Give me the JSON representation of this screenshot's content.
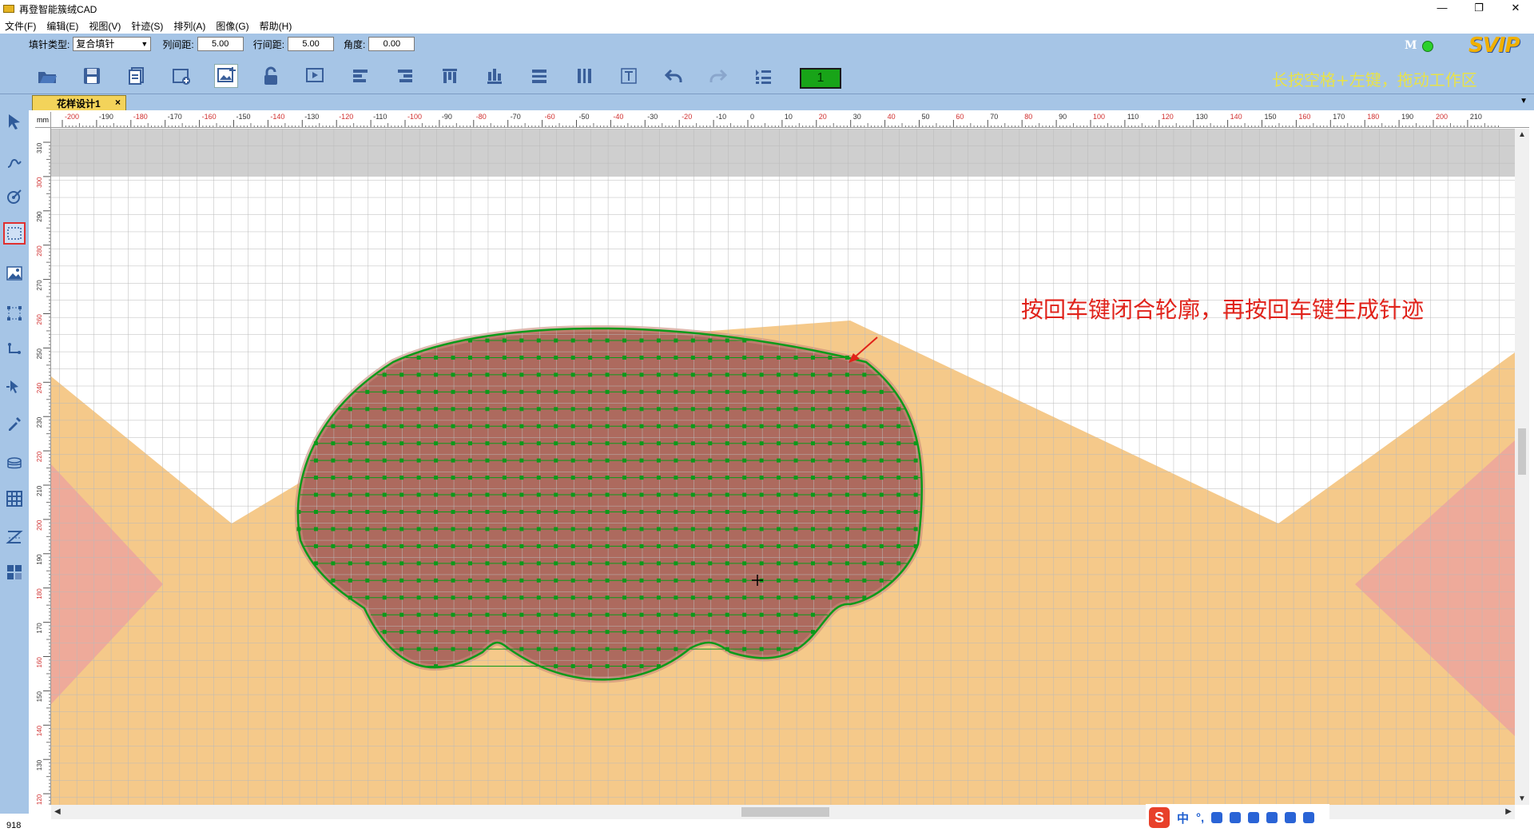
{
  "app": {
    "title": "再登智能簇绒CAD",
    "window_buttons": {
      "minimize": "—",
      "restore": "❐",
      "close": "✕"
    }
  },
  "menu": [
    "文件(F)",
    "编辑(E)",
    "视图(V)",
    "针迹(S)",
    "排列(A)",
    "图像(G)",
    "帮助(H)"
  ],
  "params": {
    "fill_type_label": "填针类型:",
    "fill_type_value": "复合填针",
    "col_spacing_label": "列间距:",
    "col_spacing_value": "5.00",
    "row_spacing_label": "行间距:",
    "row_spacing_value": "5.00",
    "angle_label": "角度:",
    "angle_value": "0.00"
  },
  "toolbar_icons": [
    "open-icon",
    "save-icon",
    "copy-doc-icon",
    "new-doc-icon",
    "image-insert-icon",
    "lock-icon",
    "play-icon",
    "align-left-icon",
    "align-right-icon",
    "align-top-icon",
    "align-bottom-icon",
    "distribute-h-icon",
    "distribute-v-icon",
    "text-icon",
    "undo-icon",
    "redo-icon",
    "list-icon"
  ],
  "counter": "1",
  "hint_top": "长按空格+左键，拖动工作区",
  "status_m": "M",
  "svip": "SVIP",
  "tab": {
    "label": "花样设计1",
    "close": "×"
  },
  "ruler_unit": "mm",
  "hruler_ticks": [
    "-200",
    "-190",
    "-180",
    "-170",
    "-160",
    "-150",
    "-140",
    "-130",
    "-120",
    "-110",
    "-100",
    "-90",
    "-80",
    "-70",
    "-60",
    "-50",
    "-40",
    "-30",
    "-20",
    "-10",
    "0",
    "10",
    "20",
    "30",
    "40",
    "50",
    "60",
    "70",
    "80",
    "90",
    "100",
    "110",
    "120",
    "130",
    "140",
    "150",
    "160",
    "170",
    "180",
    "190",
    "200",
    "210"
  ],
  "vruler_ticks": [
    "310",
    "300",
    "290",
    "280",
    "270",
    "260",
    "250",
    "240",
    "230",
    "220",
    "210",
    "200",
    "190",
    "180",
    "170",
    "160",
    "150",
    "140",
    "130",
    "120"
  ],
  "left_tools": [
    "select-arrow-icon",
    "curve-icon",
    "node-edit-icon",
    "rect-select-icon",
    "image-icon",
    "transform-icon",
    "connect-icon",
    "pointer-plus-icon",
    "eyedropper-icon",
    "layers-icon",
    "grid-icon",
    "zigzag-icon",
    "tiles-icon"
  ],
  "annotation": "按回车键闭合轮廓，再按回车键生成针迹",
  "status_number": "918",
  "ime": {
    "logo": "S",
    "lang": "中",
    "punct": "°,"
  },
  "colors": {
    "toolbar_bg": "#a6c5e6",
    "tab_bg": "#f3d35a",
    "peach": "#f5c98a",
    "pink": "#eeaa9a",
    "brown_fill": "#ad6a5e",
    "stitch_green": "#0c9a1a",
    "annotation_red": "#e0221a"
  }
}
